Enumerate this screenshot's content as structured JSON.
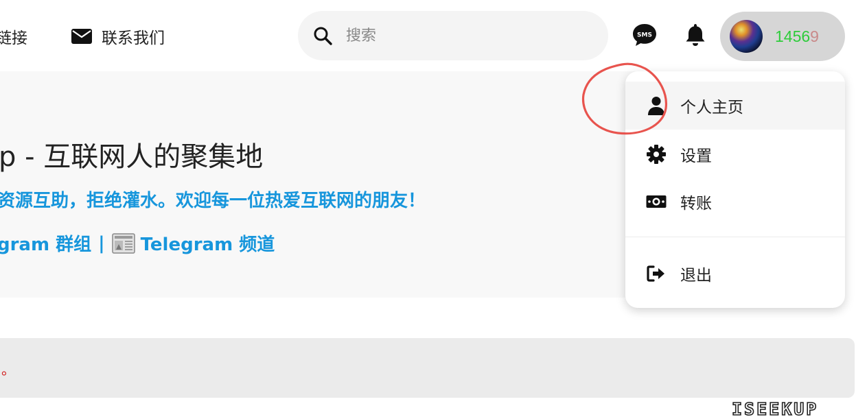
{
  "nav": {
    "friends_link": "链接",
    "contact_link": "联系我们"
  },
  "search": {
    "placeholder": "搜索"
  },
  "header": {
    "sms_icon": "sms-icon",
    "bell_icon": "bell-icon",
    "points_green": "1456",
    "points_red": "9"
  },
  "hero": {
    "title": "p - 互联网人的聚集地",
    "subtitle": "资源互助，拒绝灌水。欢迎每一位热爱互联网的朋友！",
    "group_link": "gram 群组",
    "separator": "|",
    "channel_link": "Telegram 频道"
  },
  "notice": {
    "text": "。"
  },
  "dropdown": {
    "items": [
      {
        "label": "个人主页",
        "icon": "user-icon"
      },
      {
        "label": "设置",
        "icon": "gear-icon"
      },
      {
        "label": "转账",
        "icon": "money-icon"
      },
      {
        "label": "退出",
        "icon": "logout-icon"
      }
    ]
  },
  "watermark": "ISEEKUP",
  "colors": {
    "link_blue": "#1796dc",
    "points_green": "#2dcc3a",
    "notice_red": "#d01010",
    "annotation_red": "#e8544e"
  }
}
